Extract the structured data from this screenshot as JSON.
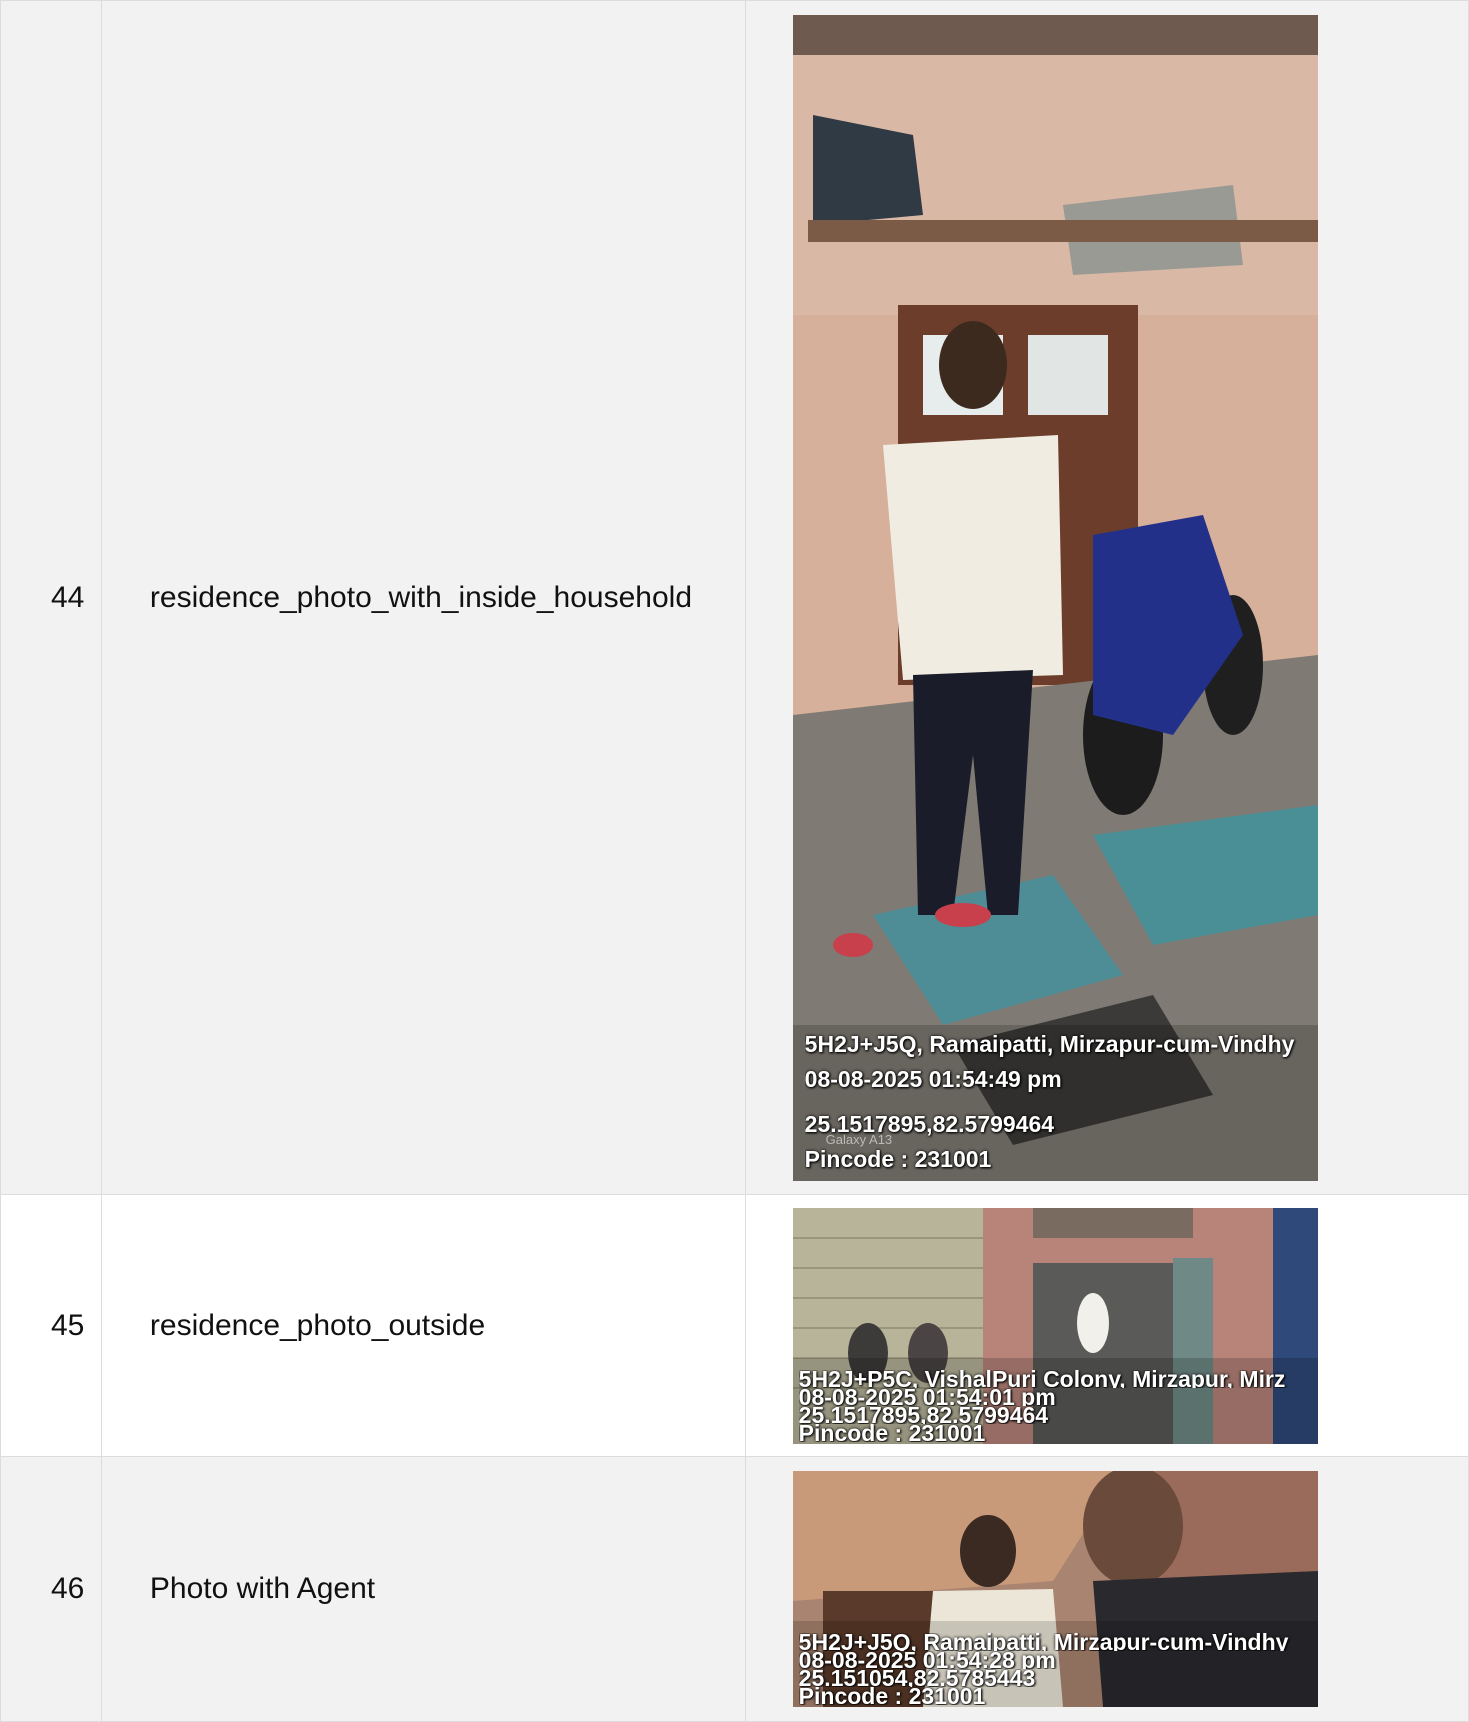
{
  "rows": [
    {
      "number": "44",
      "field": "residence_photo_with_inside_household",
      "photo": {
        "icon": "photo-man-standing-indoors-with-motorcycle",
        "stamp_lines": [
          "5H2J+J5Q, Ramaipatti, Mirzapur-cum-Vindhy",
          "08-08-2025 01:54:49 pm",
          "25.1517895,82.5799464",
          "Pincode : 231001"
        ],
        "watermark": "Galaxy A13"
      }
    },
    {
      "number": "45",
      "field": "residence_photo_outside",
      "photo": {
        "icon": "photo-house-exterior-street",
        "stamp_lines": [
          "5H2J+P5C, VishalPuri Colony, Mirzapur, Mirz",
          "08-08-2025 01:54:01 pm",
          "25.1517895,82.5799464",
          "Pincode : 231001"
        ]
      }
    },
    {
      "number": "46",
      "field": "Photo with Agent",
      "photo": {
        "icon": "photo-selfie-with-agent",
        "stamp_lines": [
          "5H2J+J5Q, Ramaipatti, Mirzapur-cum-Vindhy",
          "08-08-2025 01:54:28 pm",
          "25.151054,82.5785443",
          "Pincode : 231001"
        ]
      }
    }
  ]
}
